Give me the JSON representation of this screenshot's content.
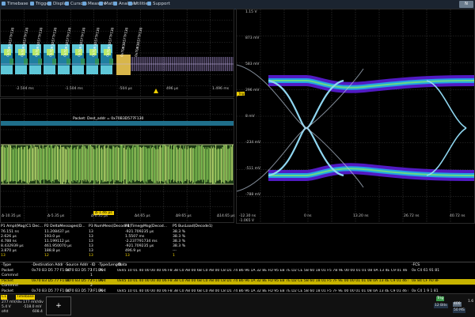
{
  "menubar": {
    "items": [
      {
        "label": "Timebase",
        "icon": "clock-icon"
      },
      {
        "label": "Trigger",
        "icon": "trigger-icon"
      },
      {
        "label": "Display",
        "icon": "display-icon"
      },
      {
        "label": "Cursors",
        "icon": "cursor-icon"
      },
      {
        "label": "Measure",
        "icon": "measure-icon"
      },
      {
        "label": "Math",
        "icon": "math-icon"
      },
      {
        "label": "Analysis",
        "icon": "analysis-icon"
      },
      {
        "label": "Utilities",
        "icon": "utilities-icon"
      },
      {
        "label": "Support",
        "icon": "support-icon"
      }
    ],
    "logo": "N"
  },
  "top_left": {
    "x_ticks": [
      "-2.504 ms",
      "-1.504 ms",
      "-504 µs",
      "496 µs",
      "1.496 ms"
    ],
    "packet_labels": [
      "0x70B3D577F130",
      "0x70B3D577F130",
      "0x70B3D577F130",
      "0x70B3D577F130",
      "0x70B3D577F130",
      "0x70B3D577F130",
      "0x70B3D577F130",
      "0x70B3D577F130",
      "0x70B3D577F130",
      "0x70B3D577F130"
    ]
  },
  "mid_left": {
    "packet_banner": "Packet: Dest_addr = 0x70B3D577F130",
    "x_ticks": [
      "Δ-10.35 µs",
      "Δ-5.35 µs",
      "Δ-0.35 µs",
      "Δ4.65 µs",
      "Δ9.65 µs",
      "Δ14.65 µs"
    ],
    "time_label": "Δ-1.46 µs"
  },
  "eye": {
    "y_ticks": [
      "1.15 V",
      "873 mV",
      "583 mV",
      "296 mV",
      "8 mV",
      "-234 mV",
      "-511 mV",
      "-788 mV",
      "-1.065 V"
    ],
    "x_ticks": [
      "-12.30 ns",
      "0 ns",
      "13.20 ns",
      "26.72 ns",
      "40.72 ns"
    ],
    "marker": "Trig"
  },
  "measurements": {
    "headers": [
      "P1 Ampl(Mag(C1 Dec...",
      "P2 DeltaMessages(D...",
      "P3 NumMess(Decode1)",
      "P4 Time@Msg(Decod...",
      "P5 BusLoad(Decode1)"
    ],
    "rows": [
      [
        "76.151 ns",
        "11.208437 µs",
        "13",
        "-921.709235 µs",
        "38.3 %"
      ],
      [
        "2.626 µs",
        "193.0 µs",
        "13",
        "1.5507 ms",
        "38.3 %"
      ],
      [
        "4.788 ns",
        "11.199112 µs",
        "13",
        "-2.237791734 ms",
        "38.3 %"
      ],
      [
        "8.432939 µs",
        "461.950070 µs",
        "13",
        "-921.709235 µs",
        "38.3 %"
      ],
      [
        "3.870 µs",
        "188.8 µs",
        "13",
        "496.9 µs",
        "---"
      ],
      [
        "13",
        "12",
        "13",
        "13",
        "1"
      ]
    ]
  },
  "decode": {
    "headers": [
      "·Type",
      "·Destination Addr",
      "·Source Addr",
      "·ID",
      "·Type/Length",
      "·Data",
      "·FCS"
    ],
    "rows": [
      {
        "type": "Packet",
        "dest": "0x70 B3 D5 77 F1 30",
        "src": "0x70 B3 D5 77 F1 30",
        "id": "1",
        "tl": "IPv4",
        "data": "0x45 10 01 40 00 00 40 06 F8 38 C0 A8 00 6B C0 A8 00 C8 D1 74 B6 96 1A 32 8E FD 95 EB 7E D2 CE 5B 60 18 01 F5 7B 9E 00 00 01 01 08 0A 13 4E C9 01 46 F9 57",
        "fcs": "0x C4 61 91 81",
        "highlight": false
      },
      {
        "type": "Commnd",
        "dest": "",
        "src": "",
        "id": "1",
        "tl": "",
        "data": "",
        "fcs": "",
        "highlight": false
      },
      {
        "type": "Packet",
        "dest": "0x70 B3 D5 77 F1 30",
        "src": "0x70 B3 D5 77 F1 30",
        "id": "2",
        "tl": "IPv4",
        "data": "0x45 10 01 40 00 00 40 06 F8 38 C0 A8 00 6B C0 A8 00 C8 D1 74 B6 96 1A 32 8E FD 95 EB 7E D2 CE 5B 60 18 01 F5 7F 9E 00 00 01 01 08 0A 13 4E C9 01 46 F9 57",
        "fcs": "0x 84 CF A0 8F",
        "highlight": true
      },
      {
        "type": "Commnd",
        "dest": "",
        "src": "",
        "id": "2",
        "tl": "",
        "data": "",
        "fcs": "",
        "highlight": false
      },
      {
        "type": "Packet",
        "dest": "0x70 B3 D5 77 F1 30",
        "src": "0x70 B3 D5 77 F1 30",
        "id": "3",
        "tl": "IPv4",
        "data": "0x45 10 01 40 00 00 40 06 F8 38 C0 A8 00 6B C0 A8 00 C8 D1 74 B6 96 1A 32 8E FD 95 EB 7E D2 CE 5B 60 18 01 F5 7F 9E 00 00 01 01 08 0A 13 4E C9 01 46 F9 57",
        "fcs": "0x C4 1 9 1 81",
        "highlight": false
      }
    ]
  },
  "bottombar": {
    "c1_label": "C1",
    "c1_value1": "277 mV/div",
    "c1_value2": "5.4 V",
    "c1_value3": "ofst",
    "timebase_label": "Timebase",
    "tb_value1": "177 mV/div",
    "tb_value2": "-518.0 mV",
    "tb_value3": "608.4",
    "ch_left1": "mV/div",
    "ch_left2": "8 mV/div",
    "ch_left3": "ofst",
    "add_button": "+",
    "bits": "12 Bits",
    "sample_rate": "50 MS",
    "right_value": "1.6",
    "trig_label": "Trig",
    "status_value": "400"
  }
}
